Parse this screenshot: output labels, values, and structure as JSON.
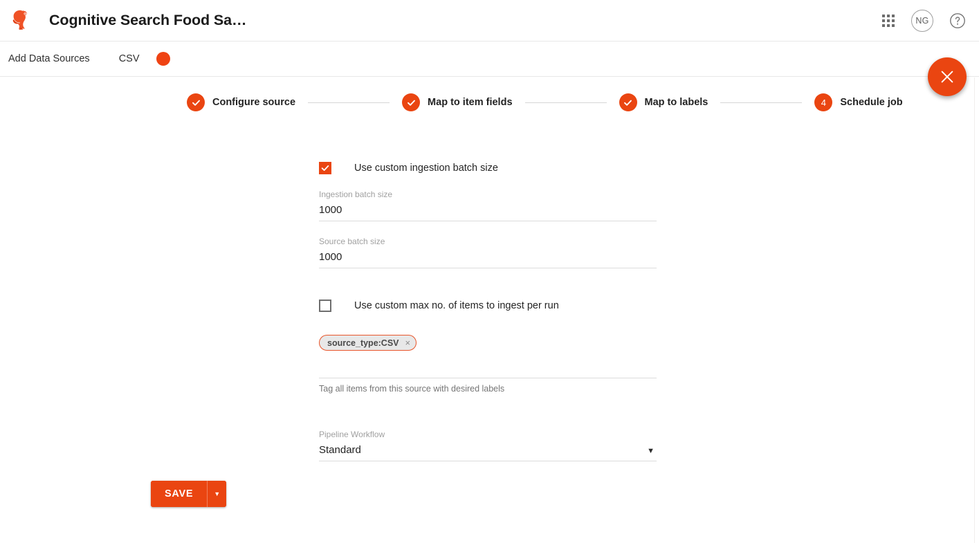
{
  "appbar": {
    "logo_icon": "squirrel-logo-icon",
    "title": "Cognitive Search Food Sa…",
    "apps_icon": "apps-grid-icon",
    "avatar_initials": "NG",
    "help_icon": "help-circle-icon"
  },
  "subbar": {
    "title": "Add Data Sources",
    "source_type": "CSV",
    "status_dot_color": "#ef4313"
  },
  "close_fab": {
    "icon": "close-icon",
    "label": "Close"
  },
  "stepper": {
    "steps": [
      {
        "marker": "✓",
        "label": "Configure source",
        "state": "complete"
      },
      {
        "marker": "✓",
        "label": "Map to item fields",
        "state": "complete"
      },
      {
        "marker": "✓",
        "label": "Map to labels",
        "state": "complete"
      },
      {
        "marker": "4",
        "label": "Schedule job",
        "state": "active"
      }
    ]
  },
  "form": {
    "custom_batch_checkbox": {
      "label": "Use custom ingestion batch size",
      "checked": true
    },
    "ingestion_batch": {
      "label": "Ingestion batch size",
      "value": "1000"
    },
    "source_batch": {
      "label": "Source batch size",
      "value": "1000"
    },
    "custom_max_items_checkbox": {
      "label": "Use custom max no. of items to ingest per run",
      "checked": false
    },
    "labels_field": {
      "chips": [
        {
          "text": "source_type:CSV",
          "remove_icon": "×"
        }
      ],
      "helper": "Tag all items from this source with desired labels"
    },
    "pipeline_workflow": {
      "label": "Pipeline Workflow",
      "value": "Standard",
      "caret": "▼"
    }
  },
  "actions": {
    "save_label": "SAVE",
    "save_split_caret": "▼"
  },
  "colors": {
    "accent": "#ea4511",
    "dot": "#ef4313",
    "chip_border": "#e8552a",
    "chip_bg": "#e8e8e8"
  }
}
